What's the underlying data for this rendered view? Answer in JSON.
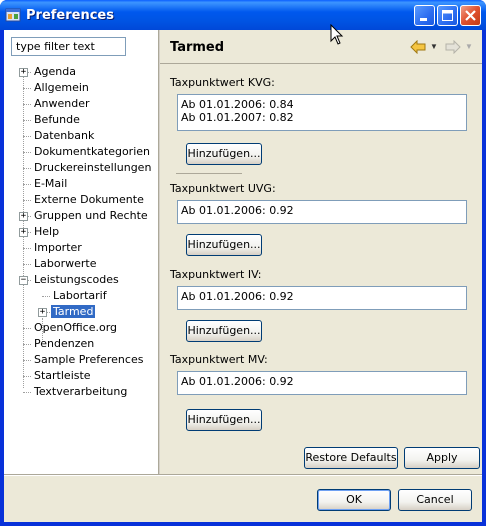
{
  "window": {
    "title": "Preferences",
    "controls": {
      "minimize": "minimize-icon",
      "maximize": "maximize-icon",
      "close": "close-icon"
    }
  },
  "filter": {
    "placeholder": "type filter text",
    "value": "type filter text"
  },
  "tree": {
    "items": [
      {
        "label": "Agenda",
        "expandable": true,
        "expanded": false
      },
      {
        "label": "Allgemein"
      },
      {
        "label": "Anwender"
      },
      {
        "label": "Befunde"
      },
      {
        "label": "Datenbank"
      },
      {
        "label": "Dokumentkategorien"
      },
      {
        "label": "Druckereinstellungen"
      },
      {
        "label": "E-Mail"
      },
      {
        "label": "Externe Dokumente"
      },
      {
        "label": "Gruppen und Rechte",
        "expandable": true,
        "expanded": false
      },
      {
        "label": "Help",
        "expandable": true,
        "expanded": false
      },
      {
        "label": "Importer"
      },
      {
        "label": "Laborwerte"
      },
      {
        "label": "Leistungscodes",
        "expandable": true,
        "expanded": true
      },
      {
        "label": "Labortarif",
        "child": true
      },
      {
        "label": "Tarmed",
        "child": true,
        "expandable": true,
        "expanded": false,
        "selected": true
      },
      {
        "label": "OpenOffice.org"
      },
      {
        "label": "Pendenzen"
      },
      {
        "label": "Sample Preferences"
      },
      {
        "label": "Startleiste"
      },
      {
        "label": "Textverarbeitung"
      }
    ]
  },
  "page": {
    "title": "Tarmed",
    "nav": {
      "back_icon": "back-arrow-icon",
      "forward_icon": "forward-arrow-icon"
    },
    "groups": [
      {
        "label": "Taxpunktwert KVG:",
        "entries": [
          "Ab 01.01.2006: 0.84",
          "Ab 01.01.2007: 0.82"
        ],
        "button": "Hinzufügen..."
      },
      {
        "label": "Taxpunktwert UVG:",
        "entries": [
          "Ab 01.01.2006: 0.92"
        ],
        "button": "Hinzufügen..."
      },
      {
        "label": "Taxpunktwert IV:",
        "entries": [
          "Ab 01.01.2006: 0.92"
        ],
        "button": "Hinzufügen..."
      },
      {
        "label": "Taxpunktwert MV:",
        "entries": [
          "Ab 01.01.2006: 0.92"
        ],
        "button": "Hinzufügen..."
      }
    ],
    "restore_defaults": "Restore Defaults",
    "apply": "Apply"
  },
  "dialog": {
    "ok": "OK",
    "cancel": "Cancel"
  },
  "colors": {
    "titlebar": "#0054e3",
    "selection": "#316ac5",
    "dialog_bg": "#ece9d8",
    "border": "#7f9db9"
  }
}
